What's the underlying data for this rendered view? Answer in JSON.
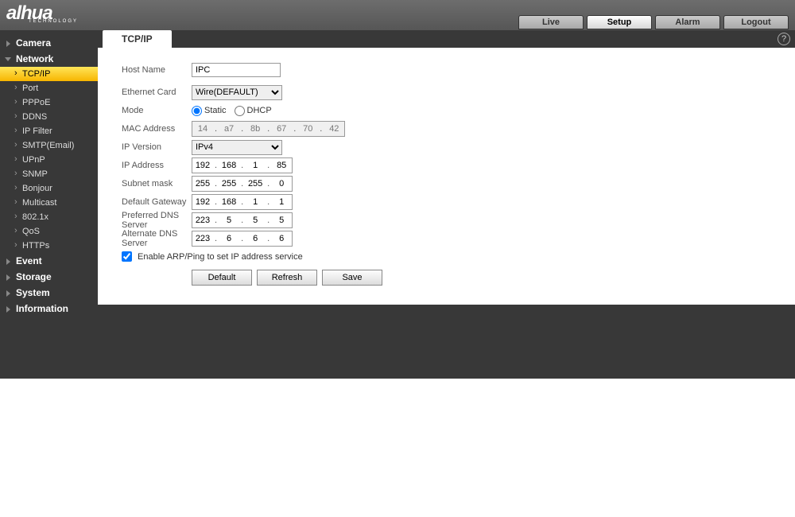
{
  "brand": {
    "name": "alhua",
    "sub": "TECHNOLOGY"
  },
  "topnav": {
    "live": "Live",
    "setup": "Setup",
    "alarm": "Alarm",
    "logout": "Logout"
  },
  "sidebar": {
    "camera": "Camera",
    "network": "Network",
    "items": [
      "TCP/IP",
      "Port",
      "PPPoE",
      "DDNS",
      "IP Filter",
      "SMTP(Email)",
      "UPnP",
      "SNMP",
      "Bonjour",
      "Multicast",
      "802.1x",
      "QoS",
      "HTTPs"
    ],
    "event": "Event",
    "storage": "Storage",
    "system": "System",
    "information": "Information"
  },
  "tab": "TCP/IP",
  "help": "?",
  "labels": {
    "hostname": "Host Name",
    "ethcard": "Ethernet Card",
    "mode": "Mode",
    "static": "Static",
    "dhcp": "DHCP",
    "mac": "MAC Address",
    "ipver": "IP Version",
    "ipaddr": "IP Address",
    "subnet": "Subnet mask",
    "gateway": "Default Gateway",
    "pdns": "Preferred DNS Server",
    "adns": "Alternate DNS Server",
    "arp": "Enable ARP/Ping to set IP address service"
  },
  "values": {
    "hostname": "IPC",
    "ethcard": "Wire(DEFAULT)",
    "ipver": "IPv4",
    "mac": [
      "14",
      "a7",
      "8b",
      "67",
      "70",
      "42"
    ],
    "ip": [
      "192",
      "168",
      "1",
      "85"
    ],
    "mask": [
      "255",
      "255",
      "255",
      "0"
    ],
    "gw": [
      "192",
      "168",
      "1",
      "1"
    ],
    "pdns": [
      "223",
      "5",
      "5",
      "5"
    ],
    "adns": [
      "223",
      "6",
      "6",
      "6"
    ]
  },
  "buttons": {
    "default": "Default",
    "refresh": "Refresh",
    "save": "Save"
  }
}
